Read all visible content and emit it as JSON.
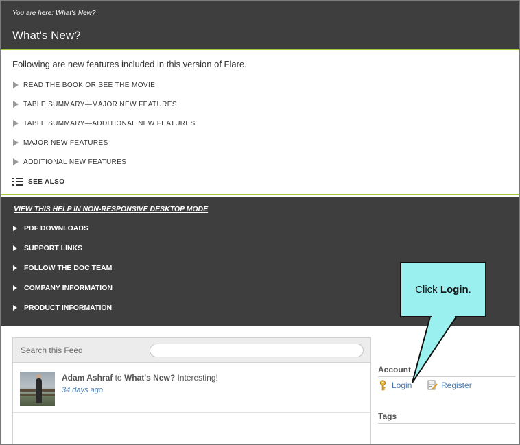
{
  "header": {
    "breadcrumb": "You are here: What's New?",
    "title": "What's New?"
  },
  "content": {
    "intro": "Following are new features included in this version of Flare.",
    "togglers": [
      {
        "label": "Read the Book or See the Movie"
      },
      {
        "label": "Table Summary—Major New Features"
      },
      {
        "label": "Table Summary—Additional New Features"
      },
      {
        "label": "Major New Features"
      },
      {
        "label": "Additional New Features"
      }
    ],
    "see_also": "SEE ALSO"
  },
  "footer": {
    "desktop_link": "VIEW THIS HELP IN NON-RESPONSIVE DESKTOP MODE",
    "items": [
      {
        "label": "PDF DOWNLOADS"
      },
      {
        "label": "SUPPORT LINKS"
      },
      {
        "label": "FOLLOW THE DOC TEAM"
      },
      {
        "label": "COMPANY INFORMATION"
      },
      {
        "label": "PRODUCT INFORMATION"
      }
    ]
  },
  "feed": {
    "title": "Search this Feed",
    "search_value": "",
    "post": {
      "author": "Adam Ashraf",
      "connector": "to",
      "topic": "What's New?",
      "message": "Interesting!",
      "time": "34 days ago"
    }
  },
  "sidebar": {
    "account_title": "Account",
    "login_label": "Login",
    "register_label": "Register",
    "tags_title": "Tags"
  },
  "callout": {
    "prefix": "Click ",
    "bold": "Login",
    "suffix": ".",
    "color": "#9af0ee"
  },
  "colors": {
    "header_bg": "#3e3e3e",
    "accent_line": "#a8c83c",
    "link": "#4a7ab0"
  },
  "icons": {
    "toggler": "triangle-right-icon",
    "see_also": "list-icon",
    "login": "key-icon",
    "register": "document-pencil-icon"
  }
}
